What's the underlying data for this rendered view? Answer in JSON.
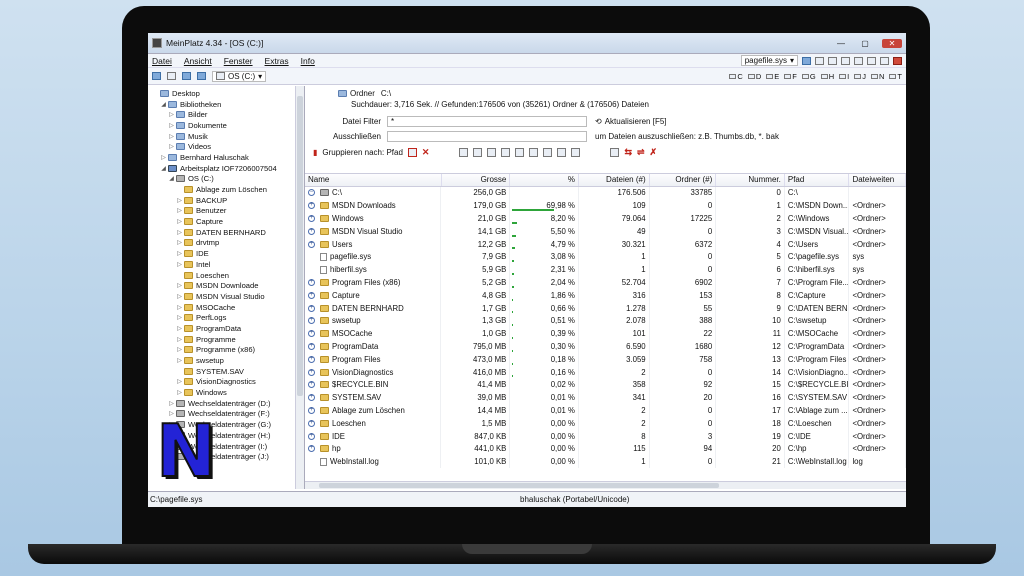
{
  "window": {
    "title": "MeinPlatz 4.34 - [OS (C:)]"
  },
  "menu": [
    "Datei",
    "Ansicht",
    "Fenster",
    "Extras",
    "Info"
  ],
  "toolbar": {
    "file_combo": "pagefile.sys",
    "drive_combo": "OS (C:)",
    "drive_letters": [
      "C",
      "D",
      "E",
      "F",
      "G",
      "H",
      "I",
      "J",
      "N",
      "T"
    ]
  },
  "tree": [
    {
      "label": "Desktop",
      "level": 0,
      "icon": "lib",
      "toggle": ""
    },
    {
      "label": "Bibliotheken",
      "level": 1,
      "icon": "lib",
      "toggle": "◢"
    },
    {
      "label": "Bilder",
      "level": 2,
      "icon": "lib",
      "toggle": "▷"
    },
    {
      "label": "Dokumente",
      "level": 2,
      "icon": "lib",
      "toggle": "▷"
    },
    {
      "label": "Musik",
      "level": 2,
      "icon": "lib",
      "toggle": "▷"
    },
    {
      "label": "Videos",
      "level": 2,
      "icon": "lib",
      "toggle": "▷"
    },
    {
      "label": "Bernhard Haluschak",
      "level": 1,
      "icon": "lib",
      "toggle": "▷"
    },
    {
      "label": "Arbeitsplatz   IOF7206007504",
      "level": 1,
      "icon": "pc",
      "toggle": "◢"
    },
    {
      "label": "OS (C:)",
      "level": 2,
      "icon": "disk",
      "toggle": "◢"
    },
    {
      "label": "Ablage zum Löschen",
      "level": 3,
      "icon": "folder",
      "toggle": ""
    },
    {
      "label": "BACKUP",
      "level": 3,
      "icon": "folder",
      "toggle": "▷"
    },
    {
      "label": "Benutzer",
      "level": 3,
      "icon": "folder",
      "toggle": "▷"
    },
    {
      "label": "Capture",
      "level": 3,
      "icon": "folder",
      "toggle": "▷"
    },
    {
      "label": "DATEN BERNHARD",
      "level": 3,
      "icon": "folder",
      "toggle": "▷"
    },
    {
      "label": "drvtmp",
      "level": 3,
      "icon": "folder",
      "toggle": "▷"
    },
    {
      "label": "IDE",
      "level": 3,
      "icon": "folder",
      "toggle": "▷"
    },
    {
      "label": "Intel",
      "level": 3,
      "icon": "folder",
      "toggle": "▷"
    },
    {
      "label": "Loeschen",
      "level": 3,
      "icon": "folder",
      "toggle": ""
    },
    {
      "label": "MSDN Downloade",
      "level": 3,
      "icon": "folder",
      "toggle": "▷"
    },
    {
      "label": "MSDN Visual Studio",
      "level": 3,
      "icon": "folder",
      "toggle": "▷"
    },
    {
      "label": "MSOCache",
      "level": 3,
      "icon": "folder",
      "toggle": "▷"
    },
    {
      "label": "PerfLogs",
      "level": 3,
      "icon": "folder",
      "toggle": "▷"
    },
    {
      "label": "ProgramData",
      "level": 3,
      "icon": "folder",
      "toggle": "▷"
    },
    {
      "label": "Programme",
      "level": 3,
      "icon": "folder",
      "toggle": "▷"
    },
    {
      "label": "Programme (x86)",
      "level": 3,
      "icon": "folder",
      "toggle": "▷"
    },
    {
      "label": "swsetup",
      "level": 3,
      "icon": "folder",
      "toggle": "▷"
    },
    {
      "label": "SYSTEM.SAV",
      "level": 3,
      "icon": "folder",
      "toggle": ""
    },
    {
      "label": "VisionDiagnostics",
      "level": 3,
      "icon": "folder",
      "toggle": "▷"
    },
    {
      "label": "Windows",
      "level": 3,
      "icon": "folder",
      "toggle": "▷"
    },
    {
      "label": "Wechseldatenträger (D:)",
      "level": 2,
      "icon": "disk",
      "toggle": "▷"
    },
    {
      "label": "Wechseldatenträger (F:)",
      "level": 2,
      "icon": "disk",
      "toggle": "▷"
    },
    {
      "label": "Wechseldatenträger (G:)",
      "level": 2,
      "icon": "disk",
      "toggle": "▷"
    },
    {
      "label": "Wechseldatenträger (H:)",
      "level": 2,
      "icon": "disk",
      "toggle": "▷"
    },
    {
      "label": "Wechseldatenträger (I:)",
      "level": 2,
      "icon": "disk",
      "toggle": "▷"
    },
    {
      "label": "Wechseldatenträger (J:)",
      "level": 2,
      "icon": "disk",
      "toggle": "▷"
    }
  ],
  "info": {
    "ordner_label": "Ordner",
    "ordner_value": "C:\\",
    "search_line": "Suchdauer: 3,716 Sek. //  Gefunden:176506 von (35261) Ordner & (176506) Dateien",
    "filter_label": "Datei Filter",
    "filter_value": "*",
    "refresh_label": "Aktualisieren [F5]",
    "exclude_label": "Ausschließen",
    "exclude_note": "um Dateien auszuschließen: z.B. Thumbs.db, *. bak",
    "group_label": "Gruppieren nach: Pfad"
  },
  "columns": [
    "Name",
    "Grosse",
    "%",
    "Dateien (#)",
    "Ordner (#)",
    "Nummer.",
    "Pfad",
    "Dateiweiten"
  ],
  "rows": [
    {
      "name": "C:\\",
      "size": "256,0 GB",
      "pct": "",
      "files": "176.506",
      "folders": "33785",
      "num": "0",
      "path": "C:\\",
      "ext": "",
      "type": "root",
      "bar": 0
    },
    {
      "name": "MSDN Downloads",
      "size": "179,0 GB",
      "pct": "69,98 %",
      "files": "109",
      "folders": "0",
      "num": "1",
      "path": "C:\\MSDN Down...",
      "ext": "<Ordner>",
      "type": "folder",
      "bar": 69.98
    },
    {
      "name": "Windows",
      "size": "21,0 GB",
      "pct": "8,20 %",
      "files": "79.064",
      "folders": "17225",
      "num": "2",
      "path": "C:\\Windows",
      "ext": "<Ordner>",
      "type": "folder",
      "bar": 8.2
    },
    {
      "name": "MSDN Visual Studio",
      "size": "14,1 GB",
      "pct": "5,50 %",
      "files": "49",
      "folders": "0",
      "num": "3",
      "path": "C:\\MSDN Visual...",
      "ext": "<Ordner>",
      "type": "folder",
      "bar": 5.5
    },
    {
      "name": "Users",
      "size": "12,2 GB",
      "pct": "4,79 %",
      "files": "30.321",
      "folders": "6372",
      "num": "4",
      "path": "C:\\Users",
      "ext": "<Ordner>",
      "type": "folder",
      "bar": 4.79
    },
    {
      "name": "pagefile.sys",
      "size": "7,9 GB",
      "pct": "3,08 %",
      "files": "1",
      "folders": "0",
      "num": "5",
      "path": "C:\\pagefile.sys",
      "ext": "sys",
      "type": "file",
      "bar": 3.08
    },
    {
      "name": "hiberfil.sys",
      "size": "5,9 GB",
      "pct": "2,31 %",
      "files": "1",
      "folders": "0",
      "num": "6",
      "path": "C:\\hiberfil.sys",
      "ext": "sys",
      "type": "file",
      "bar": 2.31
    },
    {
      "name": "Program Files (x86)",
      "size": "5,2 GB",
      "pct": "2,04 %",
      "files": "52.704",
      "folders": "6902",
      "num": "7",
      "path": "C:\\Program File...",
      "ext": "<Ordner>",
      "type": "folder",
      "bar": 2.04
    },
    {
      "name": "Capture",
      "size": "4,8 GB",
      "pct": "1,86 %",
      "files": "316",
      "folders": "153",
      "num": "8",
      "path": "C:\\Capture",
      "ext": "<Ordner>",
      "type": "folder",
      "bar": 1.86
    },
    {
      "name": "DATEN BERNHARD",
      "size": "1,7 GB",
      "pct": "0,66 %",
      "files": "1.278",
      "folders": "55",
      "num": "9",
      "path": "C:\\DATEN BERN...",
      "ext": "<Ordner>",
      "type": "folder",
      "bar": 0.66
    },
    {
      "name": "swsetup",
      "size": "1,3 GB",
      "pct": "0,51 %",
      "files": "2.078",
      "folders": "388",
      "num": "10",
      "path": "C:\\swsetup",
      "ext": "<Ordner>",
      "type": "folder",
      "bar": 0.51
    },
    {
      "name": "MSOCache",
      "size": "1,0 GB",
      "pct": "0,39 %",
      "files": "101",
      "folders": "22",
      "num": "11",
      "path": "C:\\MSOCache",
      "ext": "<Ordner>",
      "type": "folder",
      "bar": 0.39
    },
    {
      "name": "ProgramData",
      "size": "795,0 MB",
      "pct": "0,30 %",
      "files": "6.590",
      "folders": "1680",
      "num": "12",
      "path": "C:\\ProgramData",
      "ext": "<Ordner>",
      "type": "folder",
      "bar": 0.3
    },
    {
      "name": "Program Files",
      "size": "473,0 MB",
      "pct": "0,18 %",
      "files": "3.059",
      "folders": "758",
      "num": "13",
      "path": "C:\\Program Files",
      "ext": "<Ordner>",
      "type": "folder",
      "bar": 0.18
    },
    {
      "name": "VisionDiagnostics",
      "size": "416,0 MB",
      "pct": "0,16 %",
      "files": "2",
      "folders": "0",
      "num": "14",
      "path": "C:\\VisionDiagno...",
      "ext": "<Ordner>",
      "type": "folder",
      "bar": 0.16
    },
    {
      "name": "$RECYCLE.BIN",
      "size": "41,4 MB",
      "pct": "0,02 %",
      "files": "358",
      "folders": "92",
      "num": "15",
      "path": "C:\\$RECYCLE.BIN",
      "ext": "<Ordner>",
      "type": "folder",
      "bar": 0.02
    },
    {
      "name": "SYSTEM.SAV",
      "size": "39,0 MB",
      "pct": "0,01 %",
      "files": "341",
      "folders": "20",
      "num": "16",
      "path": "C:\\SYSTEM.SAV",
      "ext": "<Ordner>",
      "type": "folder",
      "bar": 0.01
    },
    {
      "name": "Ablage zum Löschen",
      "size": "14,4 MB",
      "pct": "0,01 %",
      "files": "2",
      "folders": "0",
      "num": "17",
      "path": "C:\\Ablage zum ...",
      "ext": "<Ordner>",
      "type": "folder",
      "bar": 0.01
    },
    {
      "name": "Loeschen",
      "size": "1,5 MB",
      "pct": "0,00 %",
      "files": "2",
      "folders": "0",
      "num": "18",
      "path": "C:\\Loeschen",
      "ext": "<Ordner>",
      "type": "folder",
      "bar": 0
    },
    {
      "name": "IDE",
      "size": "847,0 KB",
      "pct": "0,00 %",
      "files": "8",
      "folders": "3",
      "num": "19",
      "path": "C:\\IDE",
      "ext": "<Ordner>",
      "type": "folder",
      "bar": 0
    },
    {
      "name": "hp",
      "size": "441,0 KB",
      "pct": "0,00 %",
      "files": "115",
      "folders": "94",
      "num": "20",
      "path": "C:\\hp",
      "ext": "<Ordner>",
      "type": "folder",
      "bar": 0
    },
    {
      "name": "WebInstall.log",
      "size": "101,0 KB",
      "pct": "0,00 %",
      "files": "1",
      "folders": "0",
      "num": "21",
      "path": "C:\\WebInstall.log",
      "ext": "log",
      "type": "file",
      "bar": 0
    }
  ],
  "status": {
    "left": "C:\\pagefile.sys",
    "center": "bhaluschak (Portabel/Unicode)"
  },
  "logo": {
    "letter": "N"
  }
}
